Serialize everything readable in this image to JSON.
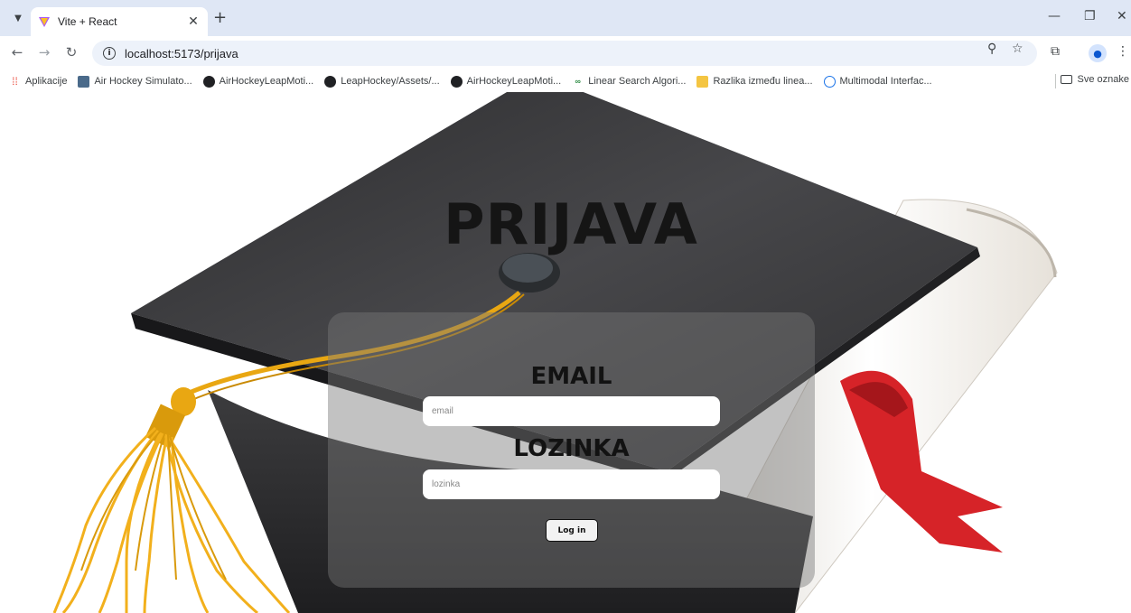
{
  "browser": {
    "tab_title": "Vite + React",
    "url": "localhost:5173/prijava",
    "bookmarks": [
      {
        "label": "Aplikacije",
        "icon": "apps-grid-icon"
      },
      {
        "label": "Air Hockey Simulato...",
        "icon": "site-icon"
      },
      {
        "label": "AirHockeyLeapMoti...",
        "icon": "github-icon"
      },
      {
        "label": "LeapHockey/Assets/...",
        "icon": "github-icon"
      },
      {
        "label": "AirHockeyLeapMoti...",
        "icon": "github-icon"
      },
      {
        "label": "Linear Search Algori...",
        "icon": "gfg-icon"
      },
      {
        "label": "Razlika između linea...",
        "icon": "note-icon"
      },
      {
        "label": "Multimodal Interfac...",
        "icon": "site-icon"
      }
    ],
    "all_bookmarks_label": "Sve oznake"
  },
  "page": {
    "title": "PRIJAVA",
    "email_label": "EMAIL",
    "email_placeholder": "email",
    "password_label": "LOZINKA",
    "password_placeholder": "lozinka",
    "login_button": "Log in"
  },
  "colors": {
    "cap": "#3a3a3c",
    "tassel": "#f2b01c",
    "ribbon": "#d62328",
    "card": "rgba(120,120,120,0.45)"
  }
}
